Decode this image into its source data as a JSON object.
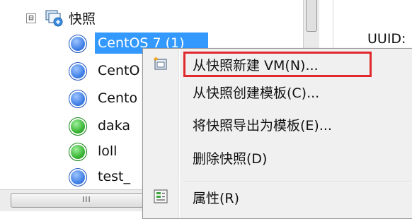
{
  "tree": {
    "root": {
      "label": "快照",
      "expander": "⊟"
    },
    "items": [
      {
        "label": "CentOS 7 (1)",
        "status": "blue"
      },
      {
        "label": "CentO",
        "status": "blue"
      },
      {
        "label": "Cento",
        "status": "blue"
      },
      {
        "label": "daka",
        "status": "green"
      },
      {
        "label": "loll",
        "status": "green"
      },
      {
        "label": "test_",
        "status": "blue"
      }
    ]
  },
  "scrollbar": {
    "grip": "III"
  },
  "details": {
    "uuid_label": "UUID:"
  },
  "context_menu": {
    "items": [
      {
        "label": "从快照新建 VM(N)...",
        "icon": "new-vm-icon",
        "highlighted": true
      },
      {
        "label": "从快照创建模板(C)...",
        "icon": ""
      },
      {
        "label": "将快照导出为模板(E)...",
        "icon": ""
      },
      {
        "label": "删除快照(D)",
        "icon": ""
      },
      {
        "label": "属性(R)",
        "icon": "properties-icon"
      }
    ]
  },
  "colors": {
    "selection": "#3399ff",
    "highlight_border": "#e0282d"
  }
}
